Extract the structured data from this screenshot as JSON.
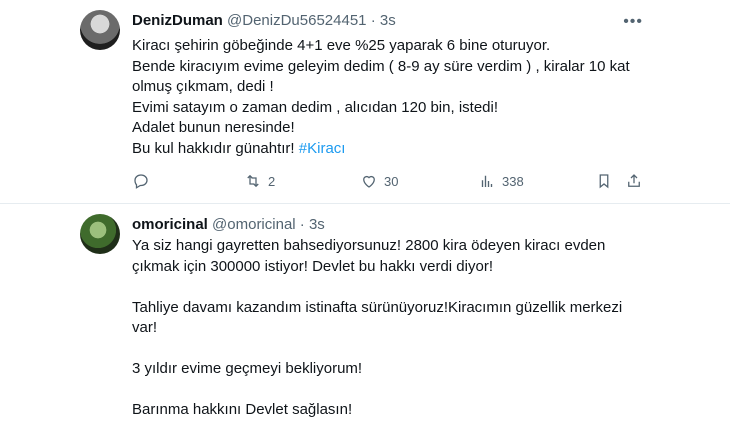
{
  "tweet1": {
    "name": "DenizDuman",
    "handle": "@DenizDu56524451",
    "time": "3s",
    "lines": [
      "Kiracı şehirin göbeğinde 4+1 eve %25 yaparak 6 bine oturuyor.",
      "Bende kiracıyım evime geleyim dedim ( 8-9 ay süre verdim ) , kiralar 10 kat",
      "olmuş çıkmam,  dedi !",
      "Evimi satayım o zaman dedim , alıcıdan 120 bin,  istedi!",
      "Adalet bunun neresinde!",
      "Bu kul hakkıdır günahtır! "
    ],
    "hashtag": "#Kiracı",
    "retweets": "2",
    "likes": "30",
    "views": "338"
  },
  "tweet2": {
    "name": "omoricinal",
    "handle": "@omoricinal",
    "time": "3s",
    "lines": [
      "Ya siz hangi gayretten bahsediyorsunuz! 2800 kira ödeyen kiracı evden",
      "çıkmak için 300000 istiyor! Devlet bu hakkı verdi diyor!",
      "Tahliye davamı kazandım istinafta sürünüyoruz!Kiracımın güzellik merkezi",
      "var!",
      "3 yıldır evime geçmeyi bekliyorum!",
      "Barınma hakkını Devlet sağlasın!"
    ]
  },
  "icons": {
    "reply": "reply-icon",
    "retweet": "retweet-icon",
    "like": "heart-icon",
    "views": "views-icon",
    "bookmark": "bookmark-icon",
    "share": "share-icon",
    "more": "more-icon"
  }
}
